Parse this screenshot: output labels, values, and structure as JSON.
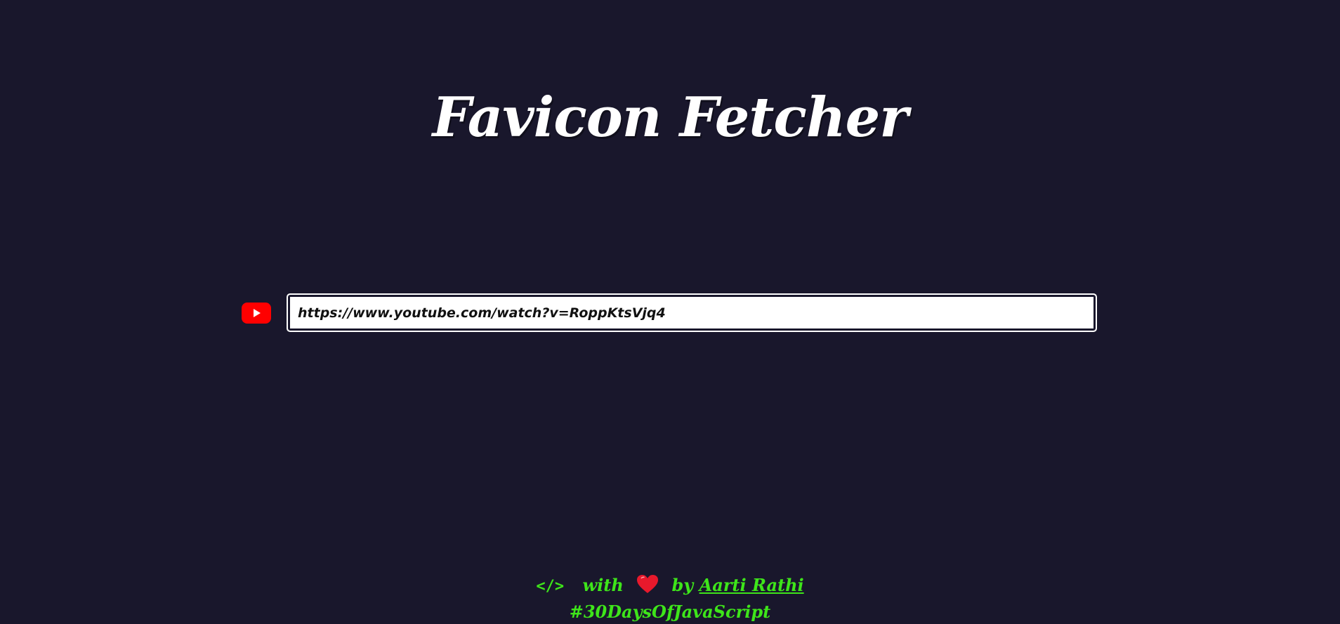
{
  "header": {
    "title": "Favicon Fetcher"
  },
  "form": {
    "favicon_icon": "youtube-play-icon",
    "url_value": "https://www.youtube.com/watch?v=RoppKtsVjq4"
  },
  "footer": {
    "code_glyph": "</>",
    "with_text": "with",
    "by_text": "by",
    "author_name": "Aarti Rathi",
    "hashtag": "#30DaysOfJavaScript",
    "accent_color": "#3ee51a",
    "heart_color": "#e8192c"
  },
  "colors": {
    "background": "#19172c",
    "title": "#ffffff",
    "youtube_red": "#ff0000"
  }
}
